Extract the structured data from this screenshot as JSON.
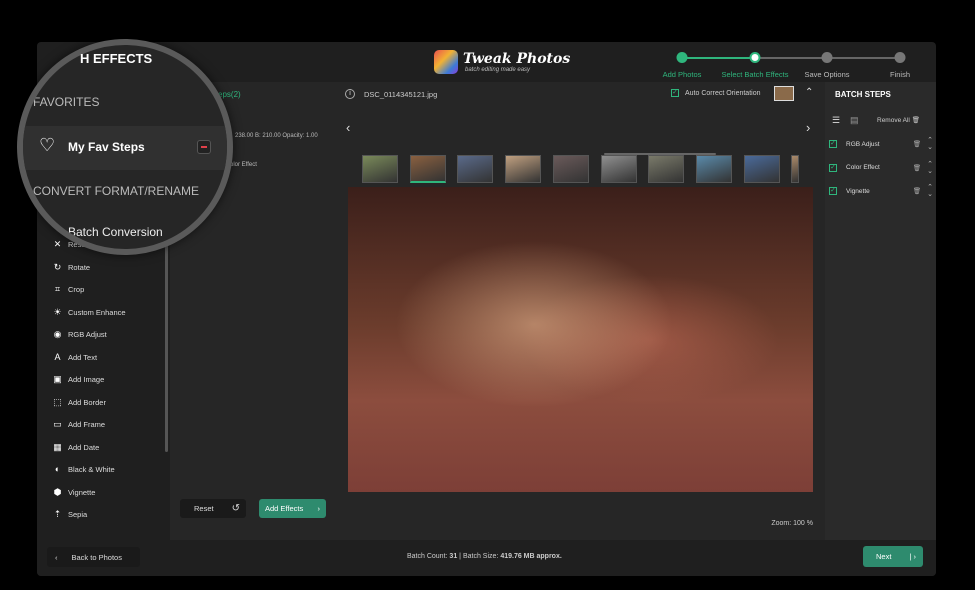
{
  "header": {
    "title": "H EFFECTS",
    "brand": "Tweak Photos",
    "tagline": "batch editing made easy",
    "steps": [
      {
        "label": "Add Photos",
        "state": "done"
      },
      {
        "label": "Select Batch Effects",
        "state": "current"
      },
      {
        "label": "Save Options",
        "state": "todo"
      },
      {
        "label": "Finish",
        "state": "todo"
      }
    ]
  },
  "magnifier": {
    "favorites": "FAVORITES",
    "fav_item": "My Fav Steps",
    "convert": "CONVERT FORMAT/RENAME",
    "batch_conversion": "Batch Conversion"
  },
  "sidebar": {
    "items": [
      {
        "label": "Resize",
        "icon": "resize-icon",
        "g": "✕"
      },
      {
        "label": "Rotate",
        "icon": "rotate-icon",
        "g": "↻"
      },
      {
        "label": "Crop",
        "icon": "crop-icon",
        "g": "⌗"
      },
      {
        "label": "Custom Enhance",
        "icon": "enhance-icon",
        "g": "☀"
      },
      {
        "label": "RGB Adjust",
        "icon": "rgb-icon",
        "g": "◉"
      },
      {
        "label": "Add Text",
        "icon": "text-icon",
        "g": "A"
      },
      {
        "label": "Add Image",
        "icon": "image-icon",
        "g": "▣"
      },
      {
        "label": "Add Border",
        "icon": "border-icon",
        "g": "⬚"
      },
      {
        "label": "Add Frame",
        "icon": "frame-icon",
        "g": "▭"
      },
      {
        "label": "Add Date",
        "icon": "date-icon",
        "g": "▦"
      },
      {
        "label": "Black & White",
        "icon": "bw-icon",
        "g": "◐"
      },
      {
        "label": "Vignette",
        "icon": "vignette-icon",
        "g": "⬢"
      },
      {
        "label": "Sepia",
        "icon": "sepia-icon",
        "g": "⇡"
      }
    ]
  },
  "middle": {
    "title_fragment": "eps(2)",
    "detail_fragment": "238.00 B: 210.00 Opacity: 1.00",
    "effect_fragment": "olor Effect",
    "reset": "Reset",
    "add_effects": "Add Effects"
  },
  "main": {
    "filename": "DSC_0114345121.jpg",
    "auto_correct": "Auto Correct Orientation",
    "zoom": "Zoom: 100 %",
    "thumb_count": 10,
    "selected_thumb": 1
  },
  "batch_steps": {
    "title": "BATCH STEPS",
    "remove_all": "Remove  All",
    "items": [
      "RGB Adjust",
      "Color Effect",
      "Vignette"
    ]
  },
  "footer": {
    "back": "Back to Photos",
    "batch_count_label": "Batch Count:",
    "batch_count": "31",
    "sep": "|",
    "batch_size_label": "Batch Size:",
    "batch_size": "419.76 MB approx.",
    "next": "Next"
  },
  "colors": {
    "accent": "#2fb67d",
    "button": "#2e8b6e",
    "bg": "#1f1f1f",
    "panel": "#262626"
  }
}
